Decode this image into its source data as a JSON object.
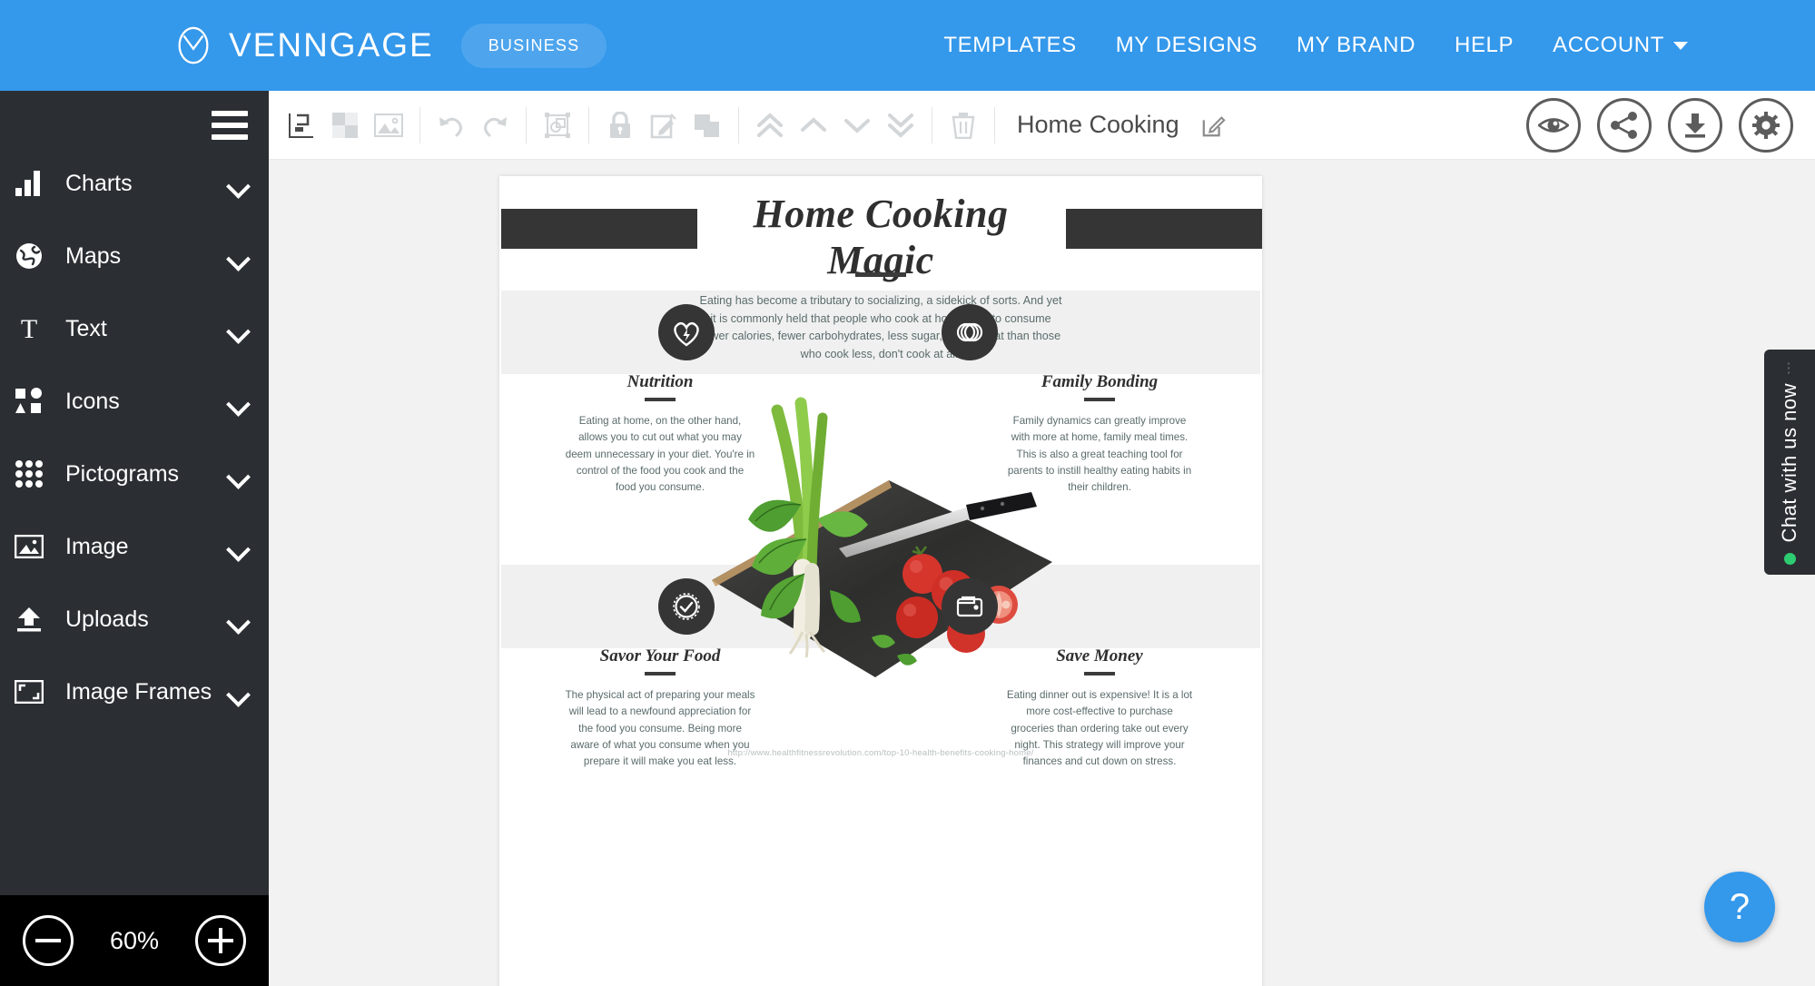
{
  "topnav": {
    "brand_name": "VENNGAGE",
    "brand_logo_icon": "venn-circle-logo",
    "business_badge": "BUSINESS",
    "accent_color": "#3498eb",
    "links": [
      {
        "label": "TEMPLATES",
        "name": "templates"
      },
      {
        "label": "MY DESIGNS",
        "name": "my-designs"
      },
      {
        "label": "MY BRAND",
        "name": "my-brand"
      },
      {
        "label": "HELP",
        "name": "help"
      },
      {
        "label": "ACCOUNT",
        "name": "account",
        "has_caret": true
      }
    ]
  },
  "sidebar": {
    "menu_icon": "hamburger-icon",
    "background_color": "#2b2f33",
    "items": [
      {
        "label": "Charts",
        "icon": "bar-chart-icon"
      },
      {
        "label": "Maps",
        "icon": "globe-icon"
      },
      {
        "label": "Text",
        "icon": "text-t-icon"
      },
      {
        "label": "Icons",
        "icon": "shapes-icon"
      },
      {
        "label": "Pictograms",
        "icon": "dot-grid-icon"
      },
      {
        "label": "Image",
        "icon": "picture-icon"
      },
      {
        "label": "Uploads",
        "icon": "upload-arrow-icon"
      },
      {
        "label": "Image Frames",
        "icon": "frame-corners-icon"
      }
    ],
    "zoom": {
      "level": "60%",
      "minus_label": "zoom-out",
      "plus_label": "zoom-in"
    }
  },
  "toolbar": {
    "document_title": "Home Cooking",
    "tools": [
      {
        "name": "align-icon",
        "enabled": true
      },
      {
        "name": "background-icon",
        "enabled": false
      },
      {
        "name": "image-icon",
        "enabled": false
      },
      {
        "name": "undo-icon",
        "enabled": false
      },
      {
        "name": "redo-icon",
        "enabled": false
      },
      {
        "name": "group-icon",
        "enabled": false
      },
      {
        "name": "lock-icon",
        "enabled": false
      },
      {
        "name": "edit-icon",
        "enabled": false
      },
      {
        "name": "duplicate-icon",
        "enabled": false
      },
      {
        "name": "bring-to-front-icon",
        "enabled": false
      },
      {
        "name": "bring-forward-icon",
        "enabled": false
      },
      {
        "name": "send-backward-icon",
        "enabled": false
      },
      {
        "name": "send-to-back-icon",
        "enabled": false
      },
      {
        "name": "delete-icon",
        "enabled": false
      }
    ],
    "title_edit_icon": "pencil-square-icon",
    "actions": [
      {
        "name": "preview-button",
        "icon": "eye-icon"
      },
      {
        "name": "share-button",
        "icon": "share-icon"
      },
      {
        "name": "download-button",
        "icon": "download-icon"
      },
      {
        "name": "settings-button",
        "icon": "gear-icon"
      }
    ]
  },
  "canvas": {
    "infographic": {
      "title": "Home Cooking Magic",
      "intro": "Eating has become a tributary to socializing, a sidekick of sorts. And yet it is commonly held that people who cook at home tend to consume fewer calories, fewer carbohydrates, less sugar, and less fat than those who cook less, don't cook at all.",
      "source_url": "http://www.healthfitnessrevolution.com/top-10-health-benefits-cooking-home/",
      "photo_alt": "cutting board with scallions, basil and tomatoes and a knife",
      "sections": [
        {
          "heading": "Nutrition",
          "icon": "heart-bolt-icon",
          "body": "Eating at home, on the other hand, allows you to cut out what you may deem unnecessary in your diet. You're in control of the food you cook and the food you consume."
        },
        {
          "heading": "Family Bonding",
          "icon": "interlocking-rings-icon",
          "body": "Family dynamics can greatly improve with more at home, family meal times. This is also a great teaching tool for parents to instill healthy eating habits in their children."
        },
        {
          "heading": "Savor Your Food",
          "icon": "check-badge-icon",
          "body": "The physical act of preparing your meals will lead to a newfound appreciation for the food you consume. Being more aware of what you consume when you prepare it will make you eat less."
        },
        {
          "heading": "Save Money",
          "icon": "wallet-icon",
          "body": "Eating dinner out is expensive! It is a lot more cost-effective to purchase groceries than ordering take out every night. This strategy will improve your finances and cut down on stress."
        }
      ]
    }
  },
  "chat": {
    "label": "Chat with us now",
    "status_color": "#2ecc71",
    "grip_icon": "drag-grip-icon"
  },
  "help_fab": {
    "label": "?",
    "color": "#3498eb"
  }
}
